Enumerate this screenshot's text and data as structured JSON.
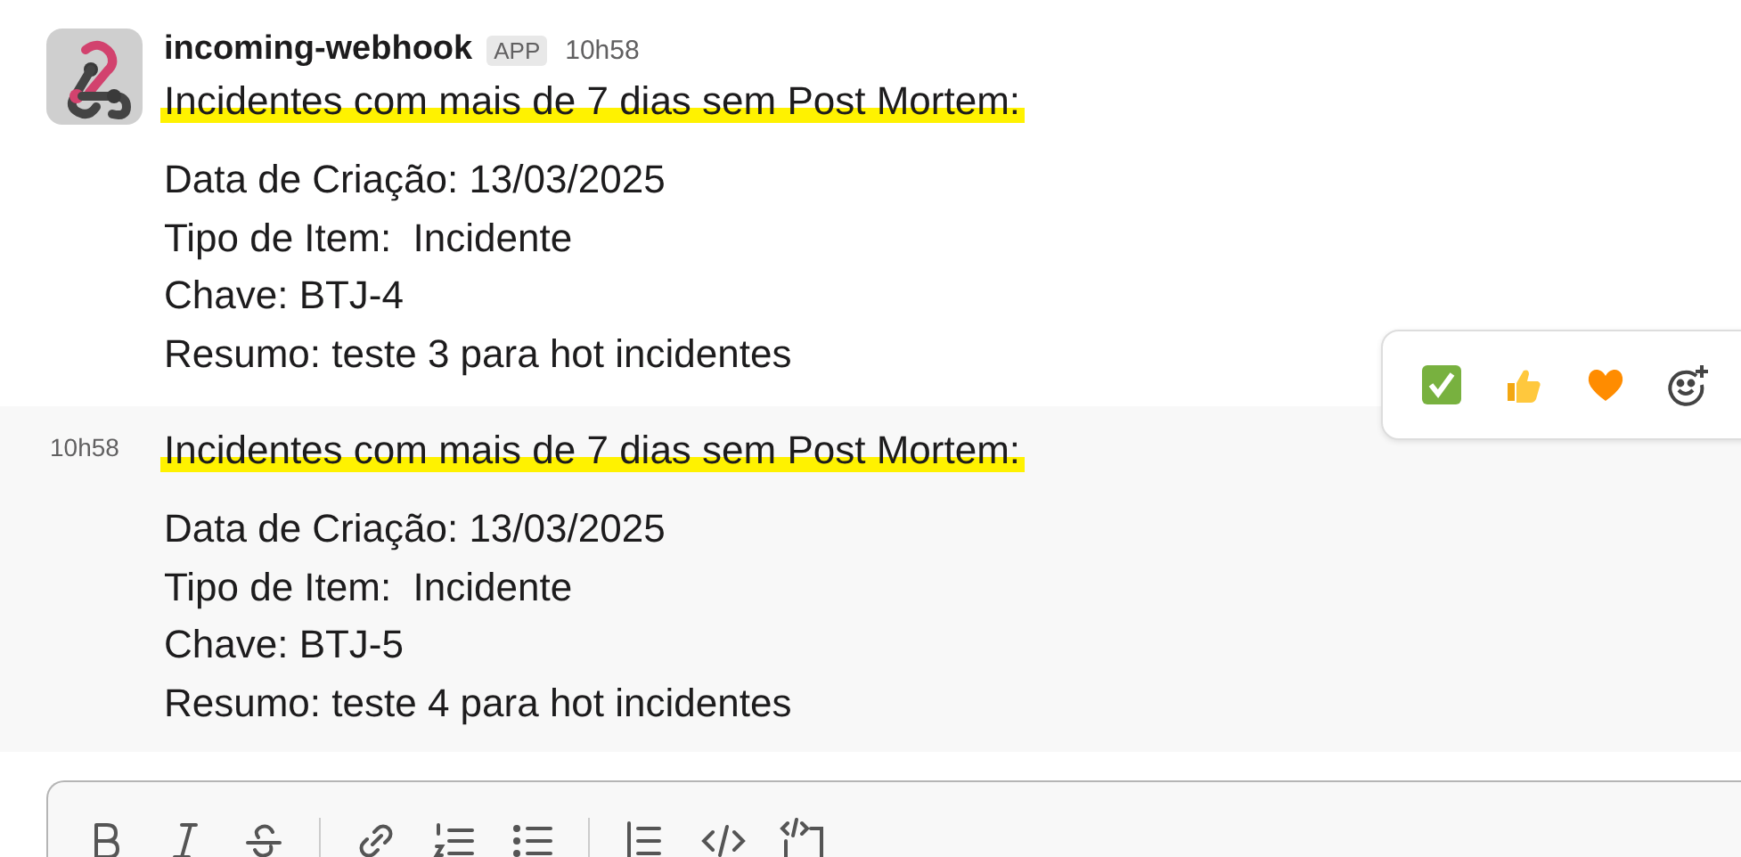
{
  "messages": [
    {
      "kind": "with_header",
      "sender": "incoming-webhook",
      "badge": "APP",
      "time": "10h58",
      "title": "Incidentes com mais de 7 dias sem Post Mortem:",
      "title_highlighted": true,
      "hovered": false,
      "lines": [
        "Data de Criação: 13/03/2025",
        "Tipo de Item:  Incidente",
        "Chave: BTJ-4",
        "Resumo: teste 3 para hot incidentes"
      ]
    },
    {
      "kind": "continuation",
      "time": "10h58",
      "title": "Incidentes com mais de 7 dias sem Post Mortem:",
      "title_highlighted": true,
      "hovered": true,
      "lines": [
        "Data de Criação: 13/03/2025",
        "Tipo de Item:  Incidente",
        "Chave: BTJ-5",
        "Resumo: teste 4 para hot incidentes"
      ]
    }
  ]
}
